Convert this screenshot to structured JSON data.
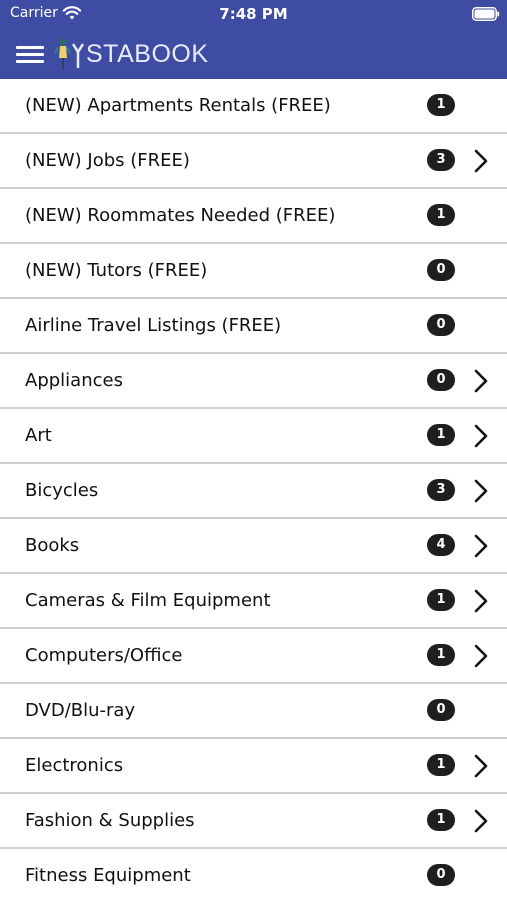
{
  "status_bar": {
    "carrier": "Carrier",
    "time": "7:48 PM"
  },
  "nav": {
    "brand": "STABOOK",
    "brand_prefix": "LY"
  },
  "categories": [
    {
      "label": "(NEW) Apartments Rentals (FREE)",
      "count": "1",
      "chevron": false
    },
    {
      "label": "(NEW) Jobs (FREE)",
      "count": "3",
      "chevron": true
    },
    {
      "label": "(NEW) Roommates Needed (FREE)",
      "count": "1",
      "chevron": false
    },
    {
      "label": "(NEW) Tutors (FREE)",
      "count": "0",
      "chevron": false
    },
    {
      "label": "Airline Travel Listings (FREE)",
      "count": "0",
      "chevron": false
    },
    {
      "label": "Appliances",
      "count": "0",
      "chevron": true
    },
    {
      "label": "Art",
      "count": "1",
      "chevron": true
    },
    {
      "label": "Bicycles",
      "count": "3",
      "chevron": true
    },
    {
      "label": "Books",
      "count": "4",
      "chevron": true
    },
    {
      "label": "Cameras & Film Equipment",
      "count": "1",
      "chevron": true
    },
    {
      "label": "Computers/Office",
      "count": "1",
      "chevron": true
    },
    {
      "label": "DVD/Blu-ray",
      "count": "0",
      "chevron": false
    },
    {
      "label": "Electronics",
      "count": "1",
      "chevron": true
    },
    {
      "label": "Fashion & Supplies",
      "count": "1",
      "chevron": true
    },
    {
      "label": "Fitness Equipment",
      "count": "0",
      "chevron": false
    }
  ],
  "colors": {
    "header": "#3f4ca3",
    "badge": "#1f1f1f",
    "divider": "#cfcfcf"
  }
}
